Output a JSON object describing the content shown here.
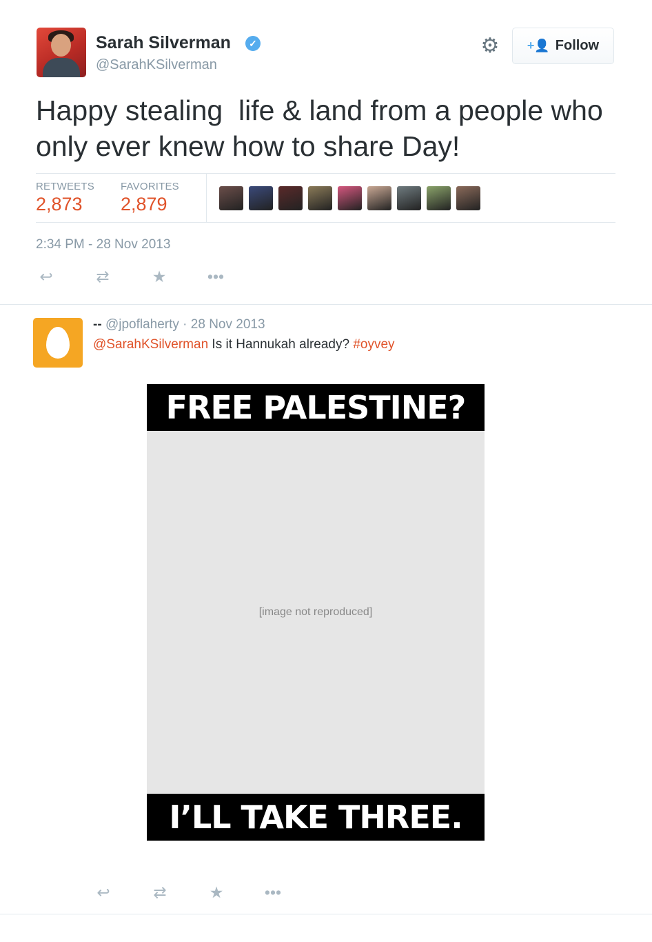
{
  "tweet": {
    "author_name": "Sarah Silverman",
    "verified_mark": "✓",
    "author_handle": "@SarahKSilverman",
    "follow_label": "Follow",
    "text": "Happy stealing  life & land from a people who only ever knew how to share Day!",
    "stats": {
      "retweets_label": "RETWEETS",
      "retweets_value": "2,873",
      "favorites_label": "FAVORITES",
      "favorites_value": "2,879"
    },
    "timestamp": "2:34 PM - 28 Nov 2013",
    "accent_color": "#e0532a",
    "favoriter_colors": [
      "#6b4e4a",
      "#3b4a7a",
      "#5a2a2a",
      "#8a7a58",
      "#d4577e",
      "#c9a894",
      "#6f7b7f",
      "#8aa36a",
      "#8a6a5a"
    ]
  },
  "reply": {
    "display_name": "--",
    "handle": "@jpoflaherty",
    "separator": "·",
    "date": "28 Nov 2013",
    "mention": "@SarahKSilverman",
    "text": " Is it Hannukah already? ",
    "hashtag": "#oyvey",
    "media": {
      "top_caption": "FREE PALESTINE?",
      "bottom_caption": "I’LL TAKE THREE.",
      "placeholder": "[image not reproduced]"
    }
  },
  "icons": {
    "gear": "gear-icon",
    "follow": "add-user-icon",
    "reply": "reply-icon",
    "retweet": "retweet-icon",
    "favorite": "star-icon",
    "more": "more-icon"
  }
}
